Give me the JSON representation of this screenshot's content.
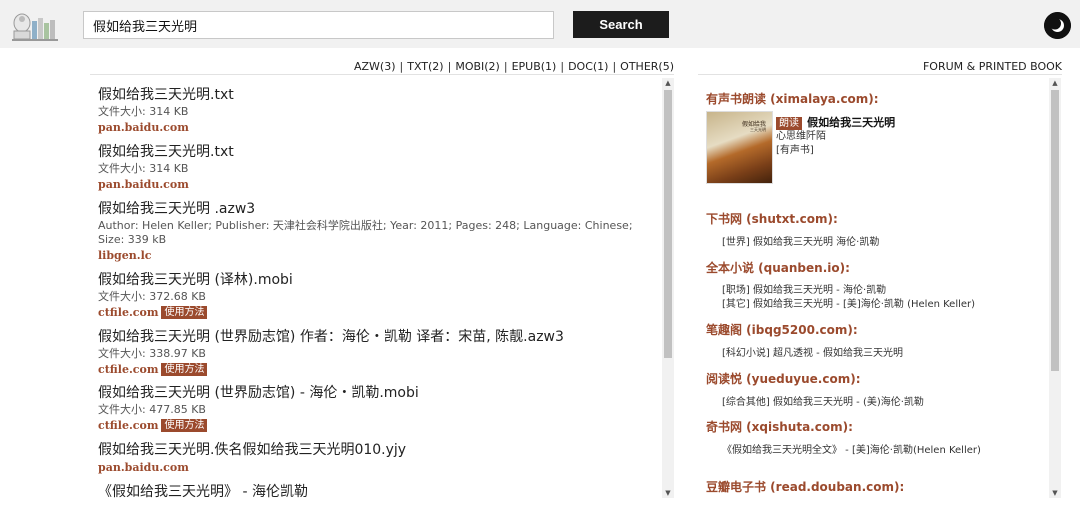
{
  "header": {
    "logo": "logo-books-icon",
    "search_value": "假如给我三天光明",
    "search_button": "Search",
    "theme_icon": "moon-icon"
  },
  "filters": [
    {
      "label": "AZW(3)"
    },
    {
      "label": "TXT(2)"
    },
    {
      "label": "MOBI(2)"
    },
    {
      "label": "EPUB(1)"
    },
    {
      "label": "DOC(1)"
    },
    {
      "label": "OTHER(5)"
    }
  ],
  "filter_separator": "|",
  "forum_link": "FORUM & PRINTED BOOK",
  "results": [
    {
      "title": "假如给我三天光明.txt",
      "meta": "文件大小: 314 KB",
      "source": "pan.baidu.com",
      "badge": ""
    },
    {
      "title": "假如给我三天光明.txt",
      "meta": "文件大小: 314 KB",
      "source": "pan.baidu.com",
      "badge": ""
    },
    {
      "title": "假如给我三天光明 .azw3",
      "meta": "Author: Helen Keller; Publisher: 天津社会科学院出版社; Year: 2011; Pages: 248; Language: Chinese; Size: 339 kB",
      "source": "libgen.lc",
      "badge": ""
    },
    {
      "title": "假如给我三天光明 (译林).mobi",
      "meta": "文件大小: 372.68 KB",
      "source": "ctfile.com",
      "badge": "使用方法"
    },
    {
      "title": "假如给我三天光明 (世界励志馆) 作者：海伦・凯勒 译者：宋苗, 陈靓.azw3",
      "meta": "文件大小: 338.97 KB",
      "source": "ctfile.com",
      "badge": "使用方法"
    },
    {
      "title": "假如给我三天光明 (世界励志馆) - 海伦・凯勒.mobi",
      "meta": "文件大小: 477.85 KB",
      "source": "ctfile.com",
      "badge": "使用方法"
    },
    {
      "title": "假如给我三天光明.佚名假如给我三天光明010.yjy",
      "meta": "",
      "source": "pan.baidu.com",
      "badge": ""
    },
    {
      "title": "《假如给我三天光明》 - 海伦凯勒",
      "meta": "",
      "source": "",
      "badge": ""
    }
  ],
  "side": {
    "audio_heading": "有声书朗读 (ximalaya.com):",
    "audio_card": {
      "listen_badge": "朗读",
      "title": "假如给我三天光明",
      "author": "心思维阡陌",
      "tag": "[有声书]",
      "cover_text_1": "假如给我",
      "cover_text_2": "三天光明"
    },
    "sections": [
      {
        "heading": "下书网 (shutxt.com):",
        "items": [
          "[世界] 假如给我三天光明 海伦·凯勒"
        ]
      },
      {
        "heading": "全本小说 (quanben.io):",
        "items": [
          "[职场] 假如给我三天光明 - 海伦·凯勒",
          "[其它] 假如给我三天光明 - [美]海伦·凯勒 (Helen Keller)"
        ]
      },
      {
        "heading": "笔趣阁 (ibqg5200.com):",
        "items": [
          "[科幻小说] 超凡透视 - 假如给我三天光明"
        ]
      },
      {
        "heading": "阅读悦 (yueduyue.com):",
        "items": [
          "[综合其他] 假如给我三天光明 - (美)海伦·凯勒"
        ]
      },
      {
        "heading": "奇书网 (xqishuta.com):",
        "items": [
          "《假如给我三天光明全文》 - [美]海伦·凯勒(Helen Keller)"
        ]
      },
      {
        "heading": "豆瓣电子书 (read.douban.com):",
        "items": []
      }
    ]
  },
  "colors": {
    "accent": "#9b4a2d",
    "button": "#1c1c1c",
    "topbar": "#f1f1f1"
  }
}
